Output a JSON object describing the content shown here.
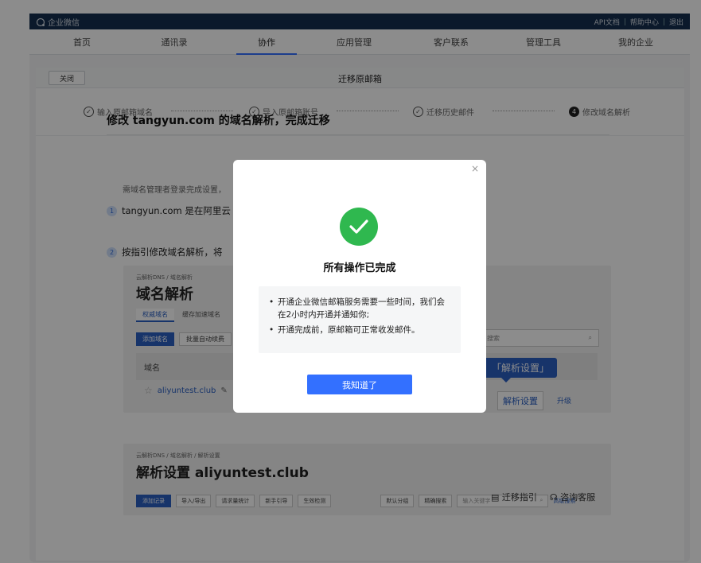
{
  "topbar": {
    "brand": "企业微信",
    "links": [
      "API文档",
      "帮助中心",
      "退出"
    ]
  },
  "nav": {
    "items": [
      {
        "label": "首页",
        "active": false
      },
      {
        "label": "通讯录",
        "active": false
      },
      {
        "label": "协作",
        "active": true
      },
      {
        "label": "应用管理",
        "active": false
      },
      {
        "label": "客户联系",
        "active": false
      },
      {
        "label": "管理工具",
        "active": false
      },
      {
        "label": "我的企业",
        "active": false
      }
    ]
  },
  "panel": {
    "close_label": "关闭",
    "title": "迁移原邮箱"
  },
  "steps": [
    {
      "label": "输入原邮箱域名",
      "done": true
    },
    {
      "label": "导入原邮箱账号",
      "done": true
    },
    {
      "label": "迁移历史邮件",
      "done": true
    },
    {
      "label": "修改域名解析",
      "done": false,
      "number": "4"
    }
  ],
  "content": {
    "heading": "修改 tangyun.com 的域名解析，完成迁移",
    "instructions": [
      {
        "n": "1",
        "text": "tangyun.com 是在阿里云"
      },
      {
        "n": "2",
        "text": "按指引修改域名解析，将"
      }
    ],
    "inst1_sub": "需域名管理者登录完成设置，",
    "shot1": {
      "crumb": "云解析DNS / 域名解析",
      "title": "域名解析",
      "tabs": [
        "权威域名",
        "缓存加速域名"
      ],
      "buttons": [
        "添加域名",
        "批量自动续费"
      ],
      "search_placeholder": "搜索",
      "col_header": "域名",
      "domain": "aliyuntest.club",
      "callout": "「解析设置」",
      "parse_btn": "解析设置",
      "upgrade": "升级"
    },
    "shot2": {
      "crumb": "云解析DNS / 域名解析 / 解析设置",
      "title": "解析设置 aliyuntest.club",
      "buttons": [
        "添加记录",
        "导入/导出",
        "请求量统计",
        "新手引导",
        "生效检测"
      ],
      "selects": [
        "默认分组",
        "精确搜索"
      ],
      "search_placeholder": "输入关键字",
      "adv": "高级搜索"
    },
    "footer_links": [
      "迁移指引",
      "咨询客服"
    ]
  },
  "modal": {
    "close": "×",
    "title": "所有操作已完成",
    "bullets": [
      "开通企业微信邮箱服务需要一些时间，我们会在2小时内开通并通知你;",
      "开通完成前，原邮箱可正常收发邮件。"
    ],
    "ok_label": "我知道了"
  }
}
